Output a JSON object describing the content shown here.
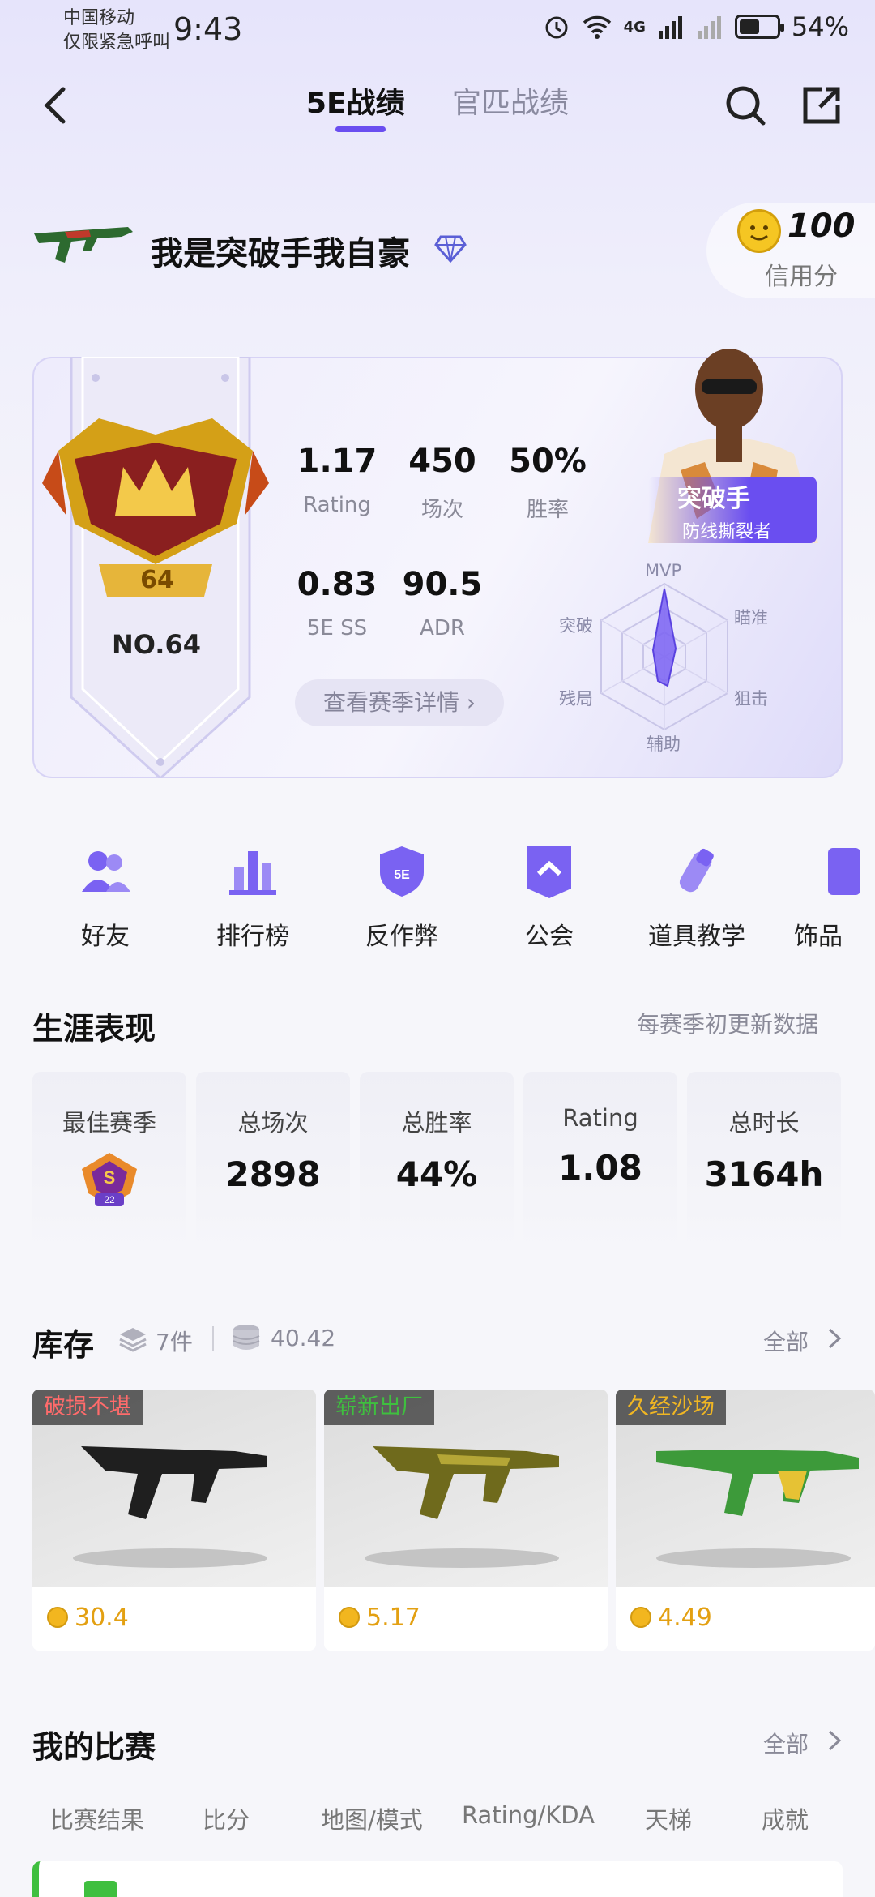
{
  "status_bar": {
    "carrier_line1": "中国移动",
    "carrier_line2": "仅限紧急呼叫",
    "time": "9:43",
    "signal_text": "4G",
    "battery": "54%",
    "battery_level": 0.54
  },
  "nav": {
    "tabs": [
      {
        "label": "5E战绩",
        "active": true
      },
      {
        "label": "官匹战绩",
        "active": false
      }
    ]
  },
  "profile": {
    "username": "我是突破手我自豪",
    "credit_score": "100",
    "credit_label": "信用分"
  },
  "season": {
    "rank_level": "64",
    "rank_no": "NO.64",
    "stats": [
      {
        "value": "1.17",
        "label": "Rating"
      },
      {
        "value": "450",
        "label": "场次"
      },
      {
        "value": "50%",
        "label": "胜率"
      },
      {
        "value": "0.83",
        "label": "5E SS"
      },
      {
        "value": "90.5",
        "label": "ADR"
      }
    ],
    "detail_button": "查看赛季详情",
    "hero_name": "突破手",
    "hero_title": "防线撕裂者",
    "radar_labels": [
      "MVP",
      "瞄准",
      "狙击",
      "辅助",
      "残局",
      "突破"
    ]
  },
  "shortcuts": [
    "好友",
    "排行榜",
    "反作弊",
    "公会",
    "道具教学",
    "饰品"
  ],
  "career": {
    "title": "生涯表现",
    "note": "每赛季初更新数据",
    "cards": [
      {
        "label": "最佳赛季",
        "value": "",
        "badge": "22"
      },
      {
        "label": "总场次",
        "value": "2898"
      },
      {
        "label": "总胜率",
        "value": "44%"
      },
      {
        "label": "Rating",
        "value": "1.08"
      },
      {
        "label": "总时长",
        "value": "3164h"
      }
    ]
  },
  "inventory": {
    "title": "库存",
    "count": "7件",
    "value": "40.42",
    "all_label": "全部",
    "items": [
      {
        "condition": "破损不堪",
        "condition_color": "#ff6b6b",
        "price": "30.4"
      },
      {
        "condition": "崭新出厂",
        "condition_color": "#3fbf3f",
        "price": "5.17"
      },
      {
        "condition": "久经沙场",
        "condition_color": "#f0b623",
        "price": "4.49"
      }
    ]
  },
  "matches": {
    "title": "我的比赛",
    "all_label": "全部",
    "columns": [
      "比赛结果",
      "比分",
      "地图/模式",
      "Rating/KDA",
      "天梯",
      "成就"
    ]
  },
  "colors": {
    "accent": "#6a4ef0",
    "gold": "#e3a012"
  }
}
